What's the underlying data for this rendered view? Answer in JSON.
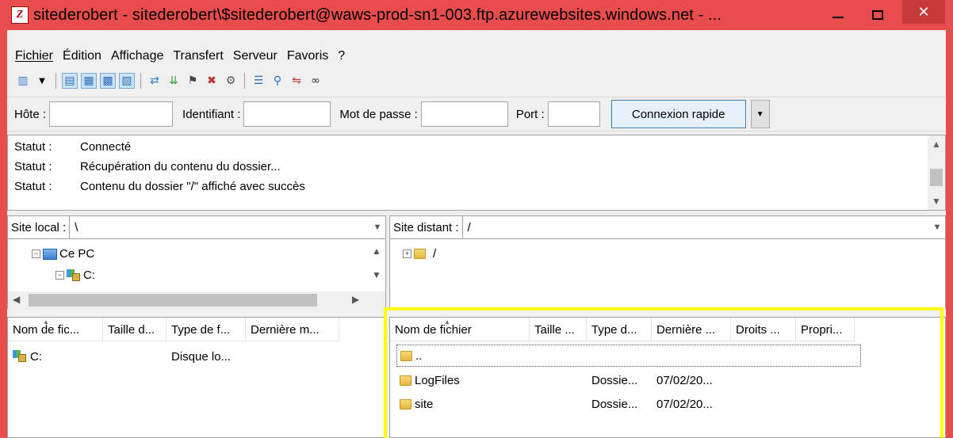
{
  "window": {
    "title": "sitederobert - sitederobert\\$sitederobert@waws-prod-sn1-003.ftp.azurewebsites.windows.net - ...",
    "app_icon": "Z",
    "colors": {
      "titlebar": "#e94c4c",
      "close": "#c73a3a",
      "highlight": "#ffff00"
    }
  },
  "menu": [
    "Fichier",
    "Édition",
    "Affichage",
    "Transfert",
    "Serveur",
    "Favoris",
    "?"
  ],
  "quickconnect": {
    "host_label": "Hôte :",
    "user_label": "Identifiant :",
    "pass_label": "Mot de passe :",
    "port_label": "Port :",
    "host_value": "",
    "user_value": "",
    "pass_value": "",
    "port_value": "",
    "connect_label": "Connexion rapide"
  },
  "log": [
    {
      "key": "Statut :",
      "msg": "Connecté"
    },
    {
      "key": "Statut :",
      "msg": "Récupération du contenu du dossier..."
    },
    {
      "key": "Statut :",
      "msg": "Contenu du dossier \"/\" affiché avec succès"
    }
  ],
  "local": {
    "site_label": "Site local :",
    "path": "\\",
    "tree": [
      {
        "label": "Ce PC",
        "icon": "pc-icon"
      },
      {
        "label": "C:",
        "icon": "drive-icon"
      }
    ],
    "columns": [
      "Nom de fic...",
      "Taille d...",
      "Type de f...",
      "Dernière m..."
    ],
    "rows": [
      {
        "name": "C:",
        "size": "",
        "type": "Disque lo...",
        "modified": ""
      }
    ]
  },
  "remote": {
    "site_label": "Site distant :",
    "path": "/",
    "tree": [
      {
        "label": "/",
        "icon": "folder-icon"
      }
    ],
    "columns": [
      "Nom de fichier",
      "Taille ...",
      "Type d...",
      "Dernière ...",
      "Droits ...",
      "Propri..."
    ],
    "rows": [
      {
        "name": "..",
        "size": "",
        "type": "",
        "modified": ""
      },
      {
        "name": "LogFiles",
        "size": "",
        "type": "Dossie...",
        "modified": "07/02/20..."
      },
      {
        "name": "site",
        "size": "",
        "type": "Dossie...",
        "modified": "07/02/20..."
      }
    ]
  }
}
